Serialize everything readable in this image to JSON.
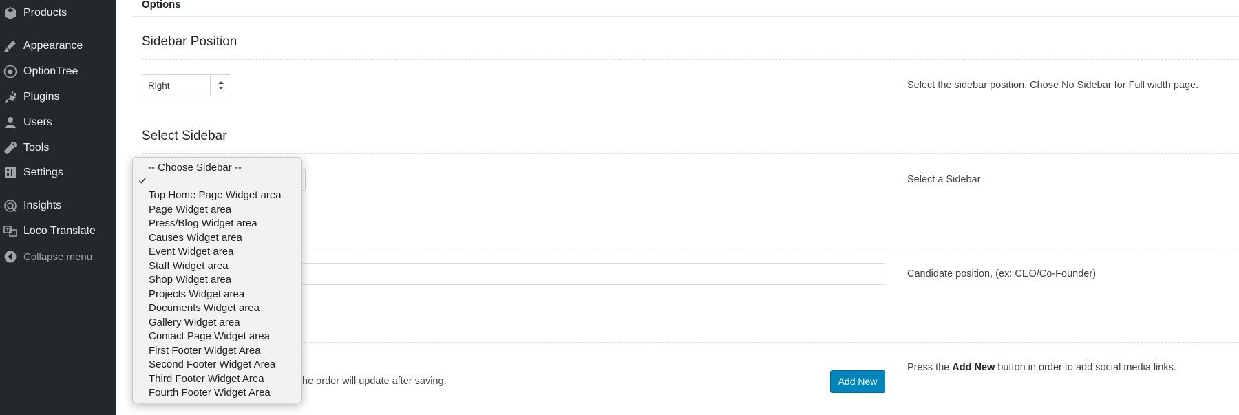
{
  "admin_menu": {
    "items": [
      {
        "label": "Products",
        "icon": "products-icon"
      },
      {
        "label": "Appearance",
        "icon": "appearance-icon"
      },
      {
        "label": "OptionTree",
        "icon": "optiontree-icon"
      },
      {
        "label": "Plugins",
        "icon": "plugins-icon"
      },
      {
        "label": "Users",
        "icon": "users-icon"
      },
      {
        "label": "Tools",
        "icon": "tools-icon"
      },
      {
        "label": "Settings",
        "icon": "settings-icon"
      },
      {
        "label": "Insights",
        "icon": "insights-icon"
      },
      {
        "label": "Loco Translate",
        "icon": "loco-translate-icon"
      }
    ],
    "collapse_label": "Collapse menu"
  },
  "panel": {
    "header": "Options"
  },
  "sidebar_position": {
    "title": "Sidebar Position",
    "selected": "Right",
    "description": "Select the sidebar position. Chose No Sidebar for Full width page."
  },
  "select_sidebar": {
    "title": "Select Sidebar",
    "description": "Select a Sidebar",
    "options": [
      "-- Choose Sidebar --",
      "",
      "Top Home Page Widget area",
      "Page Widget area",
      "Press/Blog Widget area",
      "Causes Widget area",
      "Event Widget area",
      "Staff Widget area",
      "Shop Widget area",
      "Projects Widget area",
      "Documents Widget area",
      "Gallery Widget area",
      "Contact Page Widget area",
      "First Footer Widget Area",
      "Second Footer Widget Area",
      "Third Footer Widget Area",
      "Fourth Footer Widget Area"
    ]
  },
  "candidate_position": {
    "value": "",
    "description": "Candidate position, (ex: CEO/Co-Founder)"
  },
  "social_links": {
    "helper_text": "the order will update after saving.",
    "add_new_label": "Add New",
    "description_prefix": "Press the ",
    "description_bold": "Add New",
    "description_suffix": " button in order to add social media links."
  },
  "colors": {
    "admin_menu_bg": "#23282d",
    "primary_button": "#0085ba"
  }
}
